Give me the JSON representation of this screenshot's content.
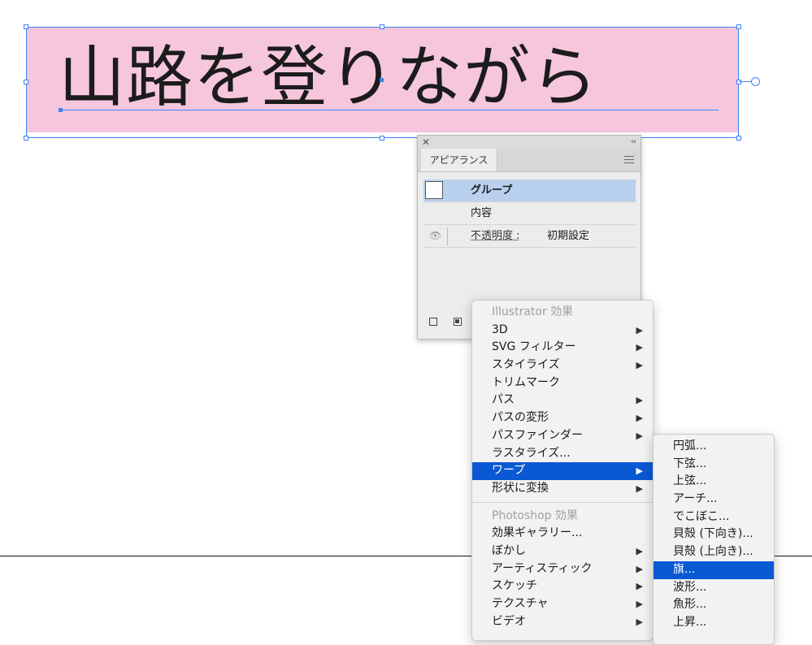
{
  "artwork": {
    "text": "山路を登りながら"
  },
  "appearance_panel": {
    "tab_label": "アピアランス",
    "close_glyph": "✕",
    "collapse_glyph": "‹‹",
    "rows": {
      "group_label": "グループ",
      "contents_label": "内容",
      "opacity_label": "不透明度 :",
      "opacity_value": "初期設定"
    }
  },
  "effect_menu": {
    "illustrator_header": "Illustrator 効果",
    "illustrator_items": [
      {
        "label": "3D",
        "has_submenu": true
      },
      {
        "label": "SVG フィルター",
        "has_submenu": true
      },
      {
        "label": "スタイライズ",
        "has_submenu": true
      },
      {
        "label": "トリムマーク",
        "has_submenu": false
      },
      {
        "label": "パス",
        "has_submenu": true
      },
      {
        "label": "パスの変形",
        "has_submenu": true
      },
      {
        "label": "パスファインダー",
        "has_submenu": true
      },
      {
        "label": "ラスタライズ...",
        "has_submenu": false
      },
      {
        "label": "ワープ",
        "has_submenu": true,
        "selected": true
      },
      {
        "label": "形状に変換",
        "has_submenu": true
      }
    ],
    "photoshop_header": "Photoshop 効果",
    "photoshop_items": [
      {
        "label": "効果ギャラリー...",
        "has_submenu": false
      },
      {
        "label": "ぼかし",
        "has_submenu": true
      },
      {
        "label": "アーティスティック",
        "has_submenu": true
      },
      {
        "label": "スケッチ",
        "has_submenu": true
      },
      {
        "label": "テクスチャ",
        "has_submenu": true
      },
      {
        "label": "ビデオ",
        "has_submenu": true
      }
    ],
    "submenu_arrow": "▶"
  },
  "warp_submenu": {
    "items": [
      {
        "label": "円弧..."
      },
      {
        "label": "下弦..."
      },
      {
        "label": "上弦..."
      },
      {
        "label": "アーチ..."
      },
      {
        "label": "でこぼこ..."
      },
      {
        "label": "貝殻 (下向き)..."
      },
      {
        "label": "貝殻 (上向き)..."
      },
      {
        "label": "旗...",
        "selected": true
      },
      {
        "label": "波形..."
      },
      {
        "label": "魚形..."
      },
      {
        "label": "上昇..."
      }
    ]
  },
  "colors": {
    "artwork_fill": "#f6c7dc",
    "selection_blue": "#3b82f6",
    "menu_highlight": "#0a59d4",
    "panel_row_selected": "#b9d1ee"
  }
}
